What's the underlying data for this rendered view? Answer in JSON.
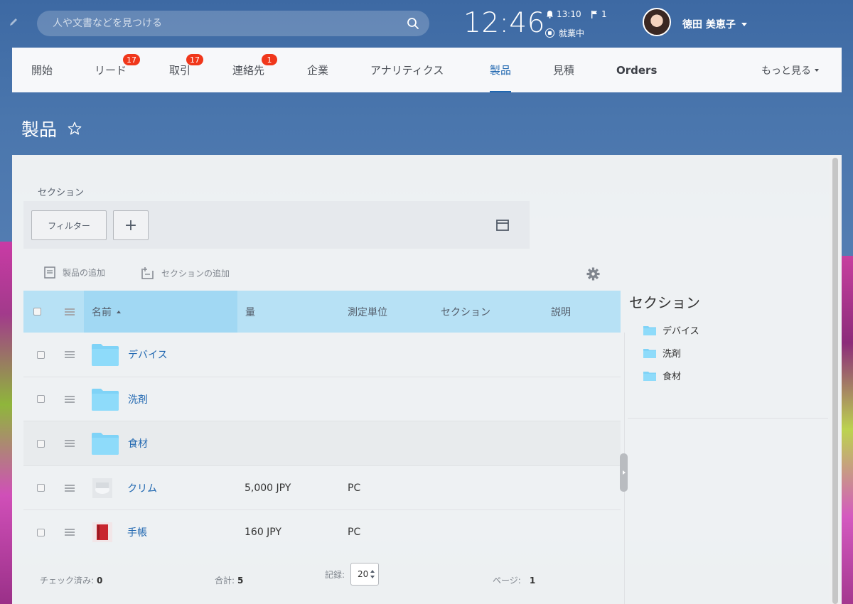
{
  "search": {
    "placeholder": "人や文書などを見つける"
  },
  "clock": "12:46",
  "alarm_time": "13:10",
  "flag_count": "1",
  "work_status": "就業中",
  "user": {
    "name": "徳田 美恵子"
  },
  "nav": {
    "items": [
      {
        "label": "開始",
        "badge": ""
      },
      {
        "label": "リード",
        "badge": "17"
      },
      {
        "label": "取引",
        "badge": "17"
      },
      {
        "label": "連絡先",
        "badge": "1"
      },
      {
        "label": "企業",
        "badge": ""
      },
      {
        "label": "アナリティクス",
        "badge": ""
      },
      {
        "label": "製品",
        "badge": "",
        "active": true
      },
      {
        "label": "見積",
        "badge": ""
      },
      {
        "label": "Orders",
        "badge": ""
      }
    ],
    "more": "もっと見る"
  },
  "page_title": "製品",
  "filter": {
    "section_label": "セクション",
    "filter_button": "フィルター",
    "add_button": "+"
  },
  "toolbar": {
    "add_product": "製品の追加",
    "add_section": "セクションの追加"
  },
  "table": {
    "headers": {
      "name": "名前",
      "quantity": "量",
      "unit": "測定単位",
      "section": "セクション",
      "description": "説明"
    },
    "rows": [
      {
        "type": "folder",
        "name": "デバイス",
        "quantity": "",
        "unit": ""
      },
      {
        "type": "folder",
        "name": "洗剤",
        "quantity": "",
        "unit": ""
      },
      {
        "type": "folder",
        "name": "食材",
        "quantity": "",
        "unit": ""
      },
      {
        "type": "product",
        "name": "クリム",
        "quantity": "5,000 JPY",
        "unit": "PC"
      },
      {
        "type": "product",
        "name": "手帳",
        "quantity": "160 JPY",
        "unit": "PC"
      }
    ]
  },
  "footer": {
    "checked_label": "チェック済み:",
    "checked_value": "0",
    "total_label": "合計:",
    "total_value": "5",
    "records_label": "記録:",
    "records_value": "20",
    "page_label": "ページ:",
    "page_value": "1"
  },
  "sidebar": {
    "title": "セクション",
    "items": [
      {
        "label": "デバイス"
      },
      {
        "label": "洗剤"
      },
      {
        "label": "食材"
      }
    ]
  },
  "colors": {
    "accent": "#2067b0",
    "badge": "#f0371b",
    "folder": "#7fd3f7",
    "header": "#b2e0f5"
  }
}
